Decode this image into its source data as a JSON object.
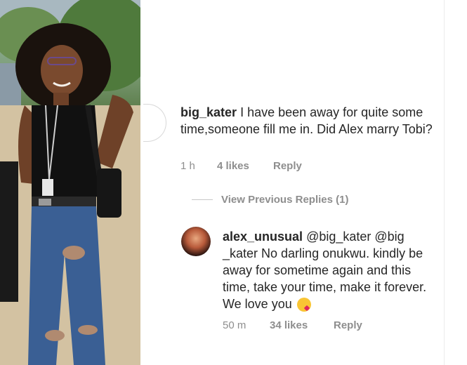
{
  "comment": {
    "username": "big_kater",
    "text": "I have been away for quite some time,someone fill me in. Did Alex marry Tobi?",
    "time": "1 h",
    "likes": "4 likes",
    "reply_label": "Reply"
  },
  "view_previous": "View Previous Replies (1)",
  "reply": {
    "username": "alex_unusual",
    "text": "@big_kater @big _kater No darling onukwu. kindly be away for sometime again and this time, take your time, make it forever. We love you",
    "emoji": "face-blowing-kiss",
    "time": "50 m",
    "likes": "34 likes",
    "reply_label": "Reply"
  },
  "colors": {
    "text": "#262626",
    "meta": "#8e8e8e"
  }
}
